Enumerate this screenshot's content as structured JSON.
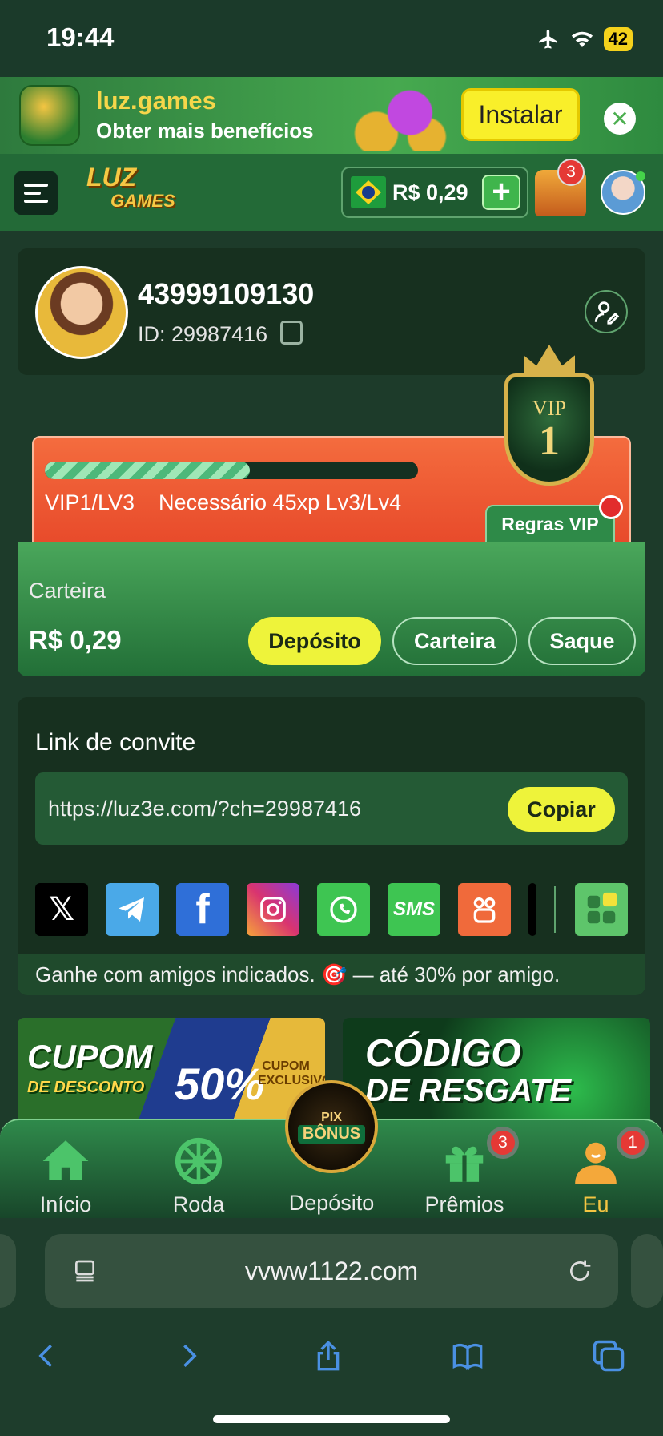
{
  "status_bar": {
    "time": "19:44",
    "battery": "42"
  },
  "install_banner": {
    "app_name": "luz.games",
    "subtitle": "Obter mais benefícios",
    "install_label": "Instalar",
    "logo_text": "LUZ GAMES"
  },
  "header": {
    "logo_line1": "LUZ",
    "logo_line2": "GAMES",
    "balance": "R$ 0,29",
    "chest_badge": "3"
  },
  "profile": {
    "username": "43999109130",
    "user_id": "ID: 29987416"
  },
  "vip": {
    "badge_title": "VIP",
    "badge_level": "1",
    "level_text": "VIP1/LV3",
    "needed_text": "Necessário 45xp Lv3/Lv4",
    "progress": 0.55,
    "rules_label": "Regras VIP"
  },
  "wallet": {
    "label": "Carteira",
    "amount": "R$ 0,29",
    "deposit_label": "Depósito",
    "wallet_label": "Carteira",
    "withdraw_label": "Saque"
  },
  "invite": {
    "title": "Link de convite",
    "link": "https://luz3e.com/?ch=29987416",
    "copy_label": "Copiar",
    "share_sms_label": "SMS",
    "footer": "Ganhe com amigos indicados. 🎯 — até 30% por amigo."
  },
  "promos": {
    "cupom_title_1": "CUPOM",
    "cupom_title_2": "DE DESCONTO",
    "cupom_percent": "50%",
    "cupom_exclusive": "CUPOM EXCLUSIVO",
    "codigo_title_1": "CÓDIGO",
    "codigo_title_2": "DE RESGATE"
  },
  "bottom_nav": {
    "home": "Início",
    "wheel": "Roda",
    "deposit": "Depósito",
    "prizes": "Prêmios",
    "prizes_badge": "3",
    "me": "Eu",
    "me_badge": "1",
    "pix_line1": "PIX",
    "pix_line2": "BÔNUS"
  },
  "browser": {
    "url": "vvww1122.com"
  },
  "colors": {
    "accent_yellow": "#eef33a",
    "brand_green": "#236a37",
    "vip_orange": "#f46c3e",
    "badge_red": "#e53935"
  }
}
